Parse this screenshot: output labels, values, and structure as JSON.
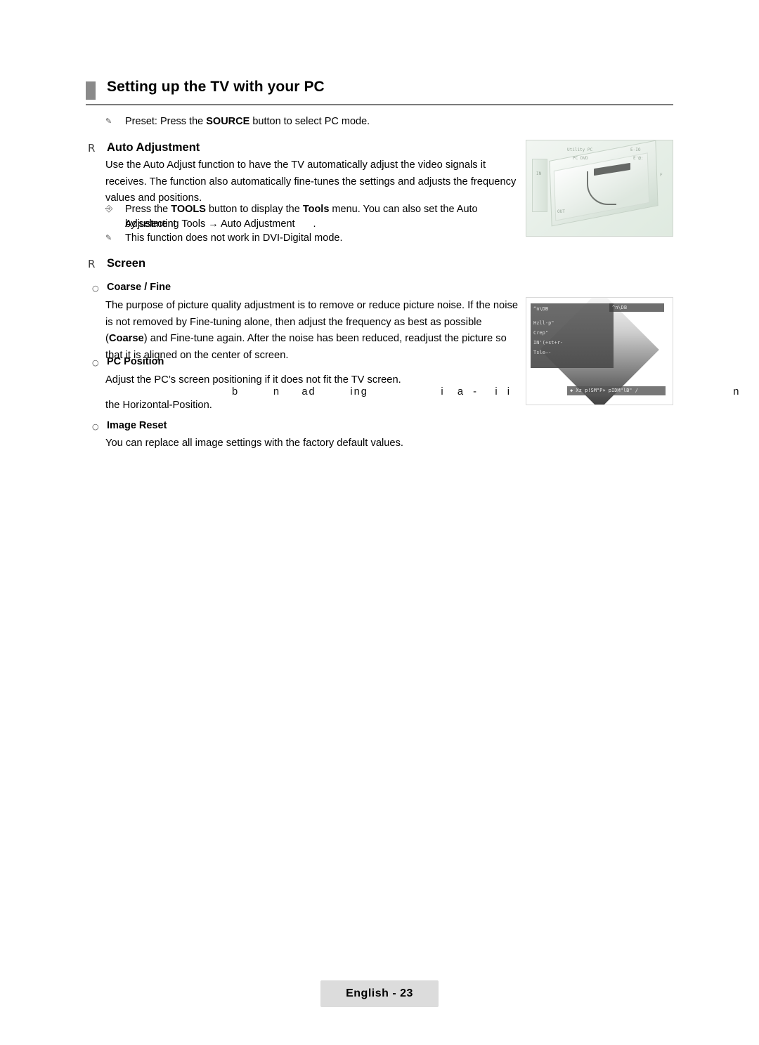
{
  "page": {
    "title": "Setting up the TV with your PC",
    "footer_label": "English - 23"
  },
  "preset_note": {
    "icon": "note-icon",
    "text_a": "Preset: Press the ",
    "text_b": "SOURCE",
    "text_c": " button to select PC mode."
  },
  "auto_adjustment": {
    "mark": "R",
    "heading": "Auto Adjustment",
    "para1": "Use the Auto Adjust function to have the TV automatically adjust the video signals it receives. The function also automatically fine-tunes the settings and adjusts the frequency values and positions.",
    "tools_note": {
      "icon": "tools-icon",
      "part1": "Press the ",
      "bold1": "TOOLS",
      "part2": " button to display the ",
      "bold2": "Tools",
      "part3": " menu. You can also set the Auto Adjustment",
      "line2": "by selecting Tools → Auto Adjustment",
      "line2_tail": "."
    },
    "dvi_note": {
      "icon": "note-icon",
      "text": "This function does not work in DVI-Digital mode."
    }
  },
  "screen": {
    "mark": "R",
    "heading": "Screen",
    "items": [
      {
        "mark": "○",
        "label": "Coarse / Fine",
        "body_a": "The purpose of picture quality adjustment is to remove or reduce picture noise. If the noise is not removed by Fine-tuning alone, then adjust the frequency as best as possible (",
        "body_bold": "Coarse",
        "body_b": ") and Fine-tune again. After the noise has been reduced, readjust the picture so that it is aligned on the center of screen."
      },
      {
        "mark": "○",
        "label": "PC Position",
        "body_a": "Adjust the PC’s screen positioning if it does not fit the TV screen.",
        "body_faded": "b        n     ad        ing                 i   a  -    i  i                                                    n",
        "body_b": "the Horizontal-Position."
      },
      {
        "mark": "○",
        "label": "Image Reset",
        "body_a": "You can replace all image settings with the factory default values."
      }
    ]
  },
  "figure_auto_adjustment": {
    "caption_bits": [
      "Utility PC",
      "E-IO",
      "E'@:",
      "PC DVD",
      "F",
      "IN",
      "OUT"
    ]
  },
  "figure_screen": {
    "menu_title": "^n\\DB",
    "menu_items": [
      "Hzll-p\"",
      "Crep\"",
      "IN'(+st+r-",
      "Tsle—-"
    ],
    "topbar_text": "^n\\DB",
    "bottombar_text": "◆ Xz p!SM\"P» pIDM\"lB\" /"
  }
}
